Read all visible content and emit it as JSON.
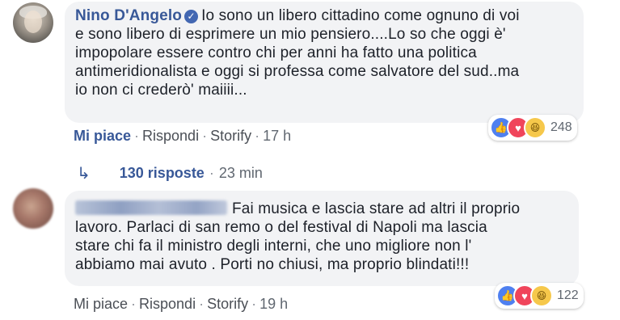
{
  "comment1": {
    "author": "Nino D'Angelo",
    "text": "Io sono un libero cittadino come ognuno di voi\ne sono libero di esprimere un mio pensiero....Lo so che oggi è'\nimpopolare essere contro chi per anni ha fatto una politica\nantimeridionalista e oggi si professa come salvatore del sud..ma\nio non ci crederò' maiiii...",
    "like": "Mi piace",
    "reply": "Rispondi",
    "storify": "Storify",
    "time": "17 h",
    "reaction_count": "248",
    "reactions": [
      "like",
      "love",
      "haha"
    ]
  },
  "replies": {
    "count_label": "130 risposte",
    "time": "23 min"
  },
  "comment2": {
    "text": "Fai musica e lascia stare ad altri il proprio\nlavoro. Parlaci di san remo o del festival di Napoli ma lascia\nstare chi fa il ministro degli interni, che uno migliore non l'\nabbiamo mai avuto . Porti no chiusi, ma proprio blindati!!!",
    "like": "Mi piace",
    "reply": "Rispondi",
    "storify": "Storify",
    "time": "19 h",
    "reaction_count": "122",
    "reactions": [
      "like",
      "love",
      "haha"
    ]
  },
  "colors": {
    "link": "#385898",
    "bubble": "#f2f3f5",
    "meta": "#606770"
  }
}
